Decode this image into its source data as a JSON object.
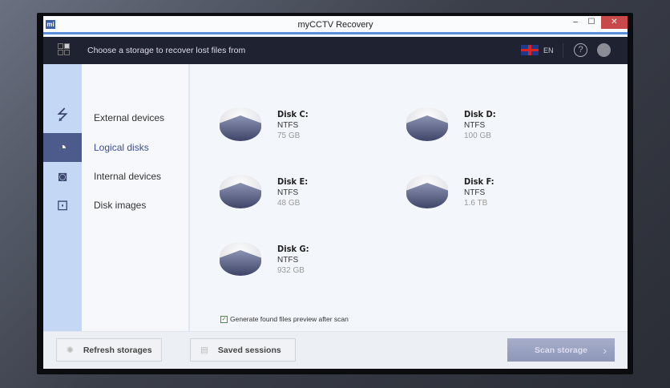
{
  "window": {
    "title": "myCCTV Recovery",
    "logo": "mi",
    "minimize": "‒",
    "maximize": "☐",
    "close": "✕"
  },
  "header": {
    "instruction": "Choose a storage to recover lost files from",
    "language": "EN",
    "help": "?"
  },
  "nav": [
    {
      "label": "External devices",
      "icon": "usb-icon",
      "glyph": "⭍"
    },
    {
      "label": "Logical disks",
      "icon": "logical-disk-icon",
      "glyph": "◔",
      "active": true
    },
    {
      "label": "Internal devices",
      "icon": "hard-drive-icon",
      "glyph": "◙"
    },
    {
      "label": "Disk images",
      "icon": "disk-image-folder-icon",
      "glyph": "⊡"
    }
  ],
  "disks": [
    {
      "name": "Disk C:",
      "fs": "NTFS",
      "size": "75 GB"
    },
    {
      "name": "Disk D:",
      "fs": "NTFS",
      "size": "100 GB"
    },
    {
      "name": "Disk E:",
      "fs": "NTFS",
      "size": "48 GB"
    },
    {
      "name": "Disk F:",
      "fs": "NTFS",
      "size": "1.6 TB"
    },
    {
      "name": "Disk G:",
      "fs": "NTFS",
      "size": "932 GB"
    }
  ],
  "options": {
    "preview_label": "Generate found files preview after scan",
    "preview_checked": true,
    "check": "✓"
  },
  "footer": {
    "refresh": "Refresh storages",
    "saved": "Saved sessions",
    "scan": "Scan storage",
    "scan_chevron": "›",
    "refresh_glyph": "✺",
    "saved_glyph": "▤"
  }
}
